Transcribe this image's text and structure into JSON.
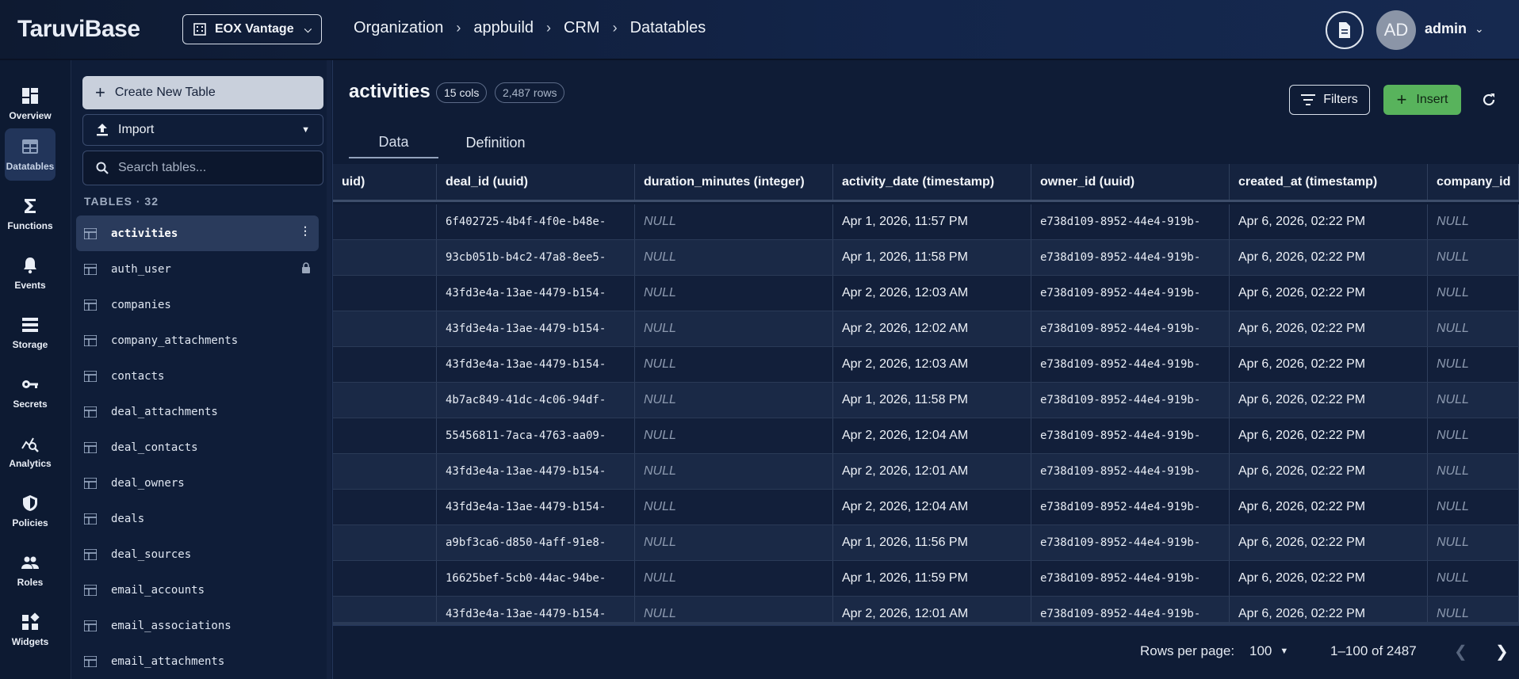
{
  "header": {
    "logo": "TaruviBase",
    "org": "EOX Vantage",
    "breadcrumb": [
      "Organization",
      "appbuild",
      "CRM",
      "Datatables"
    ],
    "avatar_initials": "AD",
    "username": "admin"
  },
  "rail": [
    {
      "label": "Overview",
      "icon": "grid-icon"
    },
    {
      "label": "Datatables",
      "icon": "table-icon",
      "active": true
    },
    {
      "label": "Functions",
      "icon": "sigma-icon"
    },
    {
      "label": "Events",
      "icon": "bell-icon"
    },
    {
      "label": "Storage",
      "icon": "storage-icon"
    },
    {
      "label": "Secrets",
      "icon": "key-icon"
    },
    {
      "label": "Analytics",
      "icon": "analytics-icon"
    },
    {
      "label": "Policies",
      "icon": "shield-icon"
    },
    {
      "label": "Roles",
      "icon": "people-icon"
    },
    {
      "label": "Widgets",
      "icon": "widgets-icon"
    }
  ],
  "panel": {
    "create_label": "Create New Table",
    "import_label": "Import",
    "search_placeholder": "Search tables...",
    "tables_heading": "TABLES · 32",
    "tables": [
      {
        "name": "activities",
        "active": true,
        "right_icon": "more-vert-icon"
      },
      {
        "name": "auth_user",
        "right_icon": "lock-icon"
      },
      {
        "name": "companies"
      },
      {
        "name": "company_attachments"
      },
      {
        "name": "contacts"
      },
      {
        "name": "deal_attachments"
      },
      {
        "name": "deal_contacts"
      },
      {
        "name": "deal_owners"
      },
      {
        "name": "deals"
      },
      {
        "name": "deal_sources"
      },
      {
        "name": "email_accounts"
      },
      {
        "name": "email_associations"
      },
      {
        "name": "email_attachments"
      }
    ]
  },
  "main": {
    "title": "activities",
    "cols_badge": "15 cols",
    "rows_badge": "2,487 rows",
    "tabs": [
      "Data",
      "Definition"
    ],
    "filters_label": "Filters",
    "insert_label": "Insert"
  },
  "grid": {
    "columns": [
      "uid)",
      "deal_id (uuid)",
      "duration_minutes (integer)",
      "activity_date (timestamp)",
      "owner_id (uuid)",
      "created_at (timestamp)",
      "company_id"
    ],
    "rows": [
      [
        "",
        "6f402725-4b4f-4f0e-b48e-",
        "NULL",
        "Apr 1, 2026, 11:57 PM",
        "e738d109-8952-44e4-919b-",
        "Apr 6, 2026, 02:22 PM",
        "NULL"
      ],
      [
        "",
        "93cb051b-b4c2-47a8-8ee5-",
        "NULL",
        "Apr 1, 2026, 11:58 PM",
        "e738d109-8952-44e4-919b-",
        "Apr 6, 2026, 02:22 PM",
        "NULL"
      ],
      [
        "",
        "43fd3e4a-13ae-4479-b154-",
        "NULL",
        "Apr 2, 2026, 12:03 AM",
        "e738d109-8952-44e4-919b-",
        "Apr 6, 2026, 02:22 PM",
        "NULL"
      ],
      [
        "",
        "43fd3e4a-13ae-4479-b154-",
        "NULL",
        "Apr 2, 2026, 12:02 AM",
        "e738d109-8952-44e4-919b-",
        "Apr 6, 2026, 02:22 PM",
        "NULL"
      ],
      [
        "",
        "43fd3e4a-13ae-4479-b154-",
        "NULL",
        "Apr 2, 2026, 12:03 AM",
        "e738d109-8952-44e4-919b-",
        "Apr 6, 2026, 02:22 PM",
        "NULL"
      ],
      [
        "",
        "4b7ac849-41dc-4c06-94df-",
        "NULL",
        "Apr 1, 2026, 11:58 PM",
        "e738d109-8952-44e4-919b-",
        "Apr 6, 2026, 02:22 PM",
        "NULL"
      ],
      [
        "",
        "55456811-7aca-4763-aa09-",
        "NULL",
        "Apr 2, 2026, 12:04 AM",
        "e738d109-8952-44e4-919b-",
        "Apr 6, 2026, 02:22 PM",
        "NULL"
      ],
      [
        "",
        "43fd3e4a-13ae-4479-b154-",
        "NULL",
        "Apr 2, 2026, 12:01 AM",
        "e738d109-8952-44e4-919b-",
        "Apr 6, 2026, 02:22 PM",
        "NULL"
      ],
      [
        "",
        "43fd3e4a-13ae-4479-b154-",
        "NULL",
        "Apr 2, 2026, 12:04 AM",
        "e738d109-8952-44e4-919b-",
        "Apr 6, 2026, 02:22 PM",
        "NULL"
      ],
      [
        "",
        "a9bf3ca6-d850-4aff-91e8-",
        "NULL",
        "Apr 1, 2026, 11:56 PM",
        "e738d109-8952-44e4-919b-",
        "Apr 6, 2026, 02:22 PM",
        "NULL"
      ],
      [
        "",
        "16625bef-5cb0-44ac-94be-",
        "NULL",
        "Apr 1, 2026, 11:59 PM",
        "e738d109-8952-44e4-919b-",
        "Apr 6, 2026, 02:22 PM",
        "NULL"
      ],
      [
        "",
        "43fd3e4a-13ae-4479-b154-",
        "NULL",
        "Apr 2, 2026, 12:01 AM",
        "e738d109-8952-44e4-919b-",
        "Apr 6, 2026, 02:22 PM",
        "NULL"
      ]
    ]
  },
  "pagination": {
    "rows_per_page_label": "Rows per page:",
    "rows_per_page": "100",
    "range": "1–100 of 2487"
  },
  "colors": {
    "insert_green": "#58b35c",
    "background": "#0f1c36",
    "active_item": "#2a3b5c"
  }
}
